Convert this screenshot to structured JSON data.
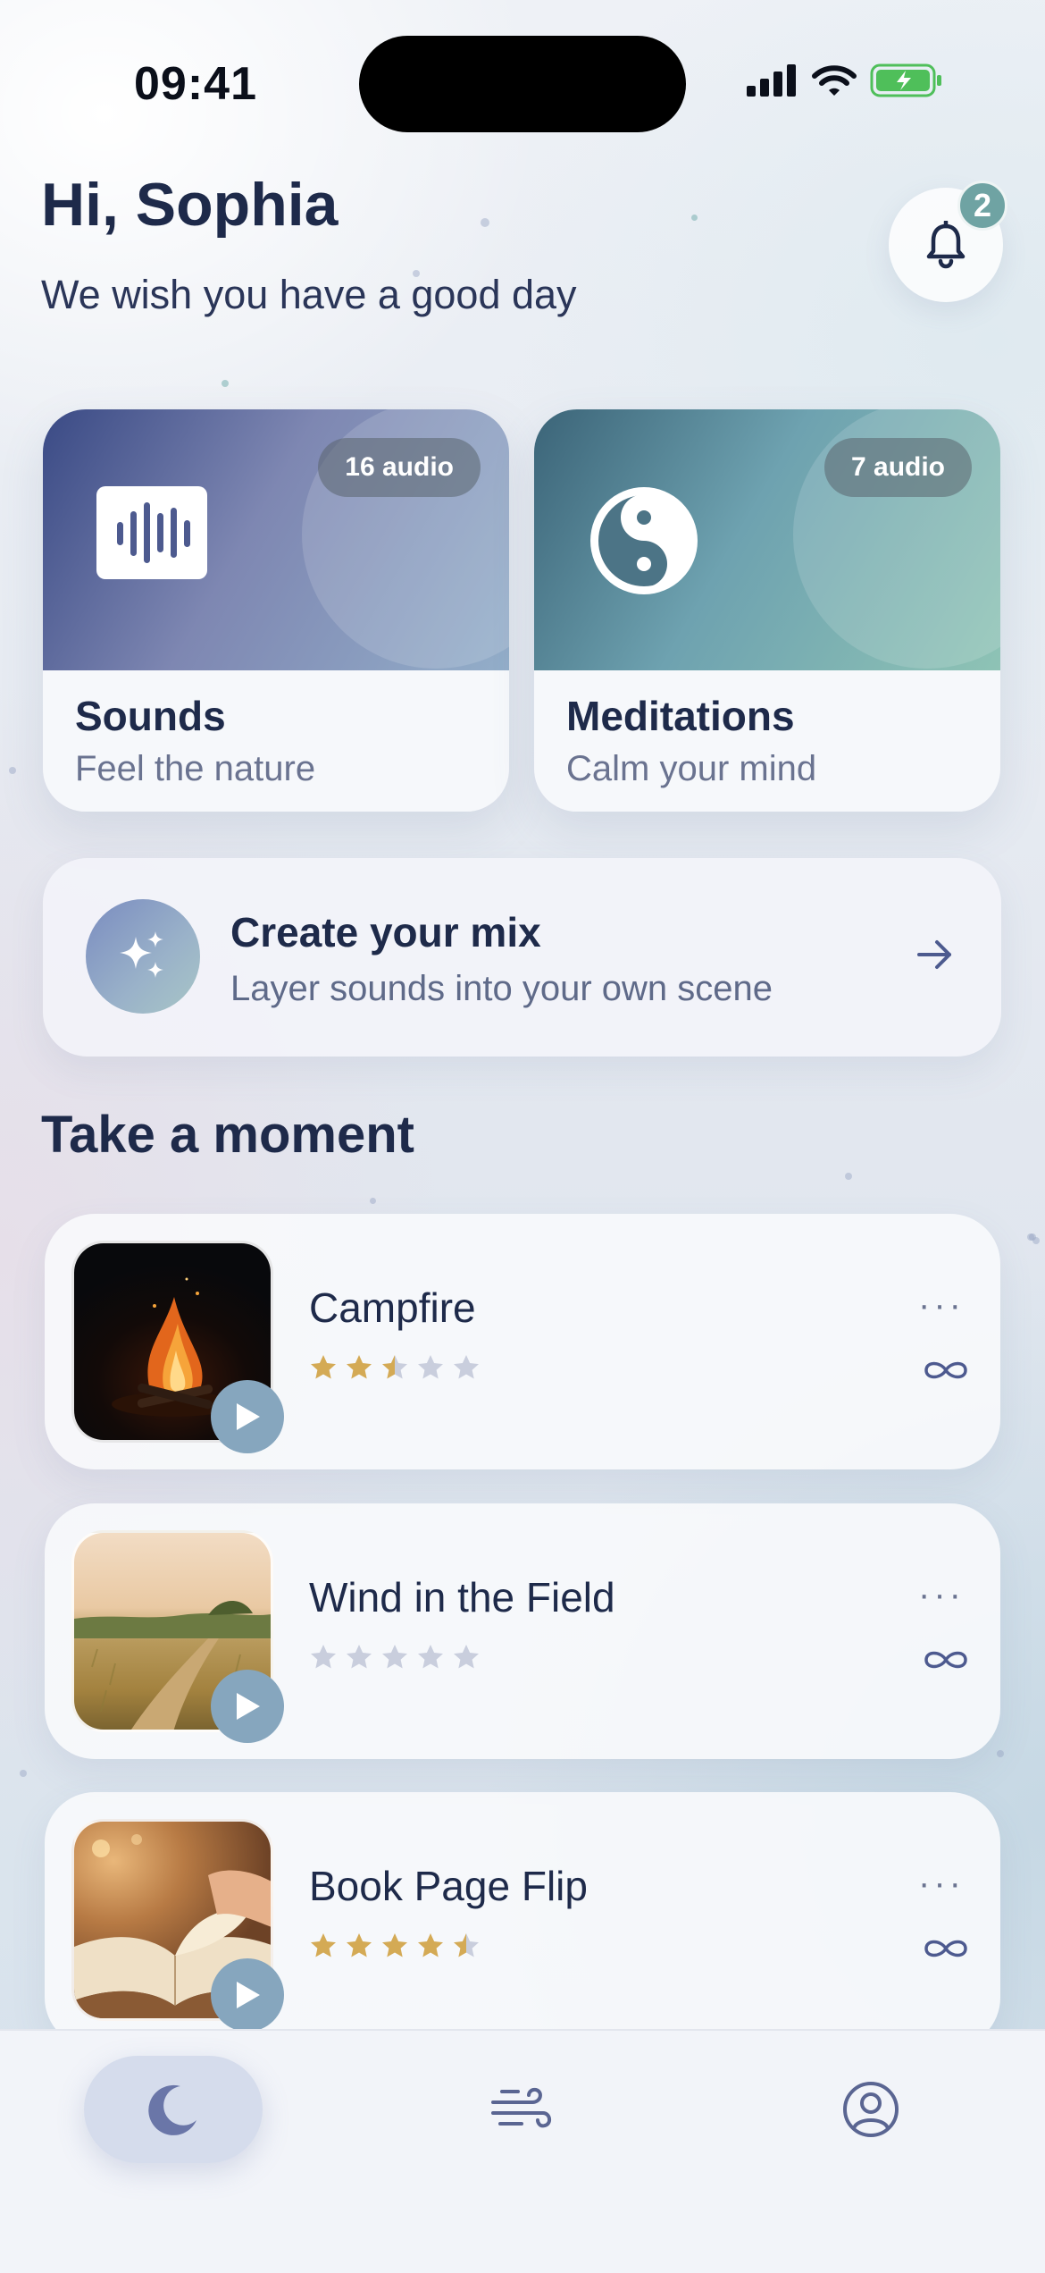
{
  "status": {
    "time": "09:41"
  },
  "header": {
    "greeting": "Hi, Sophia",
    "subtitle": "We wish you have a good day",
    "notification_count": "2"
  },
  "categories": [
    {
      "title": "Sounds",
      "subtitle": "Feel the nature",
      "count": "16 audio",
      "icon": "sound-waves-icon"
    },
    {
      "title": "Meditations",
      "subtitle": "Calm your mind",
      "count": "7 audio",
      "icon": "yin-yang-icon"
    }
  ],
  "mix": {
    "title": "Create your mix",
    "subtitle": "Layer sounds into your own scene",
    "icon": "sparkles-icon"
  },
  "section": {
    "title": "Take a moment"
  },
  "tracks": [
    {
      "title": "Campfire",
      "rating": 2.5,
      "image": "campfire"
    },
    {
      "title": "Wind in the Field",
      "rating": 0,
      "image": "field"
    },
    {
      "title": "Book Page Flip",
      "rating": 4.5,
      "image": "book"
    }
  ],
  "tabs": [
    {
      "icon": "moon-icon",
      "active": true
    },
    {
      "icon": "wind-icon",
      "active": false
    },
    {
      "icon": "profile-icon",
      "active": false
    }
  ],
  "colors": {
    "accent": "#6fa3a3",
    "star": "#d4aa55",
    "star_empty": "#c9cedd",
    "text": "#1e2a4a"
  }
}
